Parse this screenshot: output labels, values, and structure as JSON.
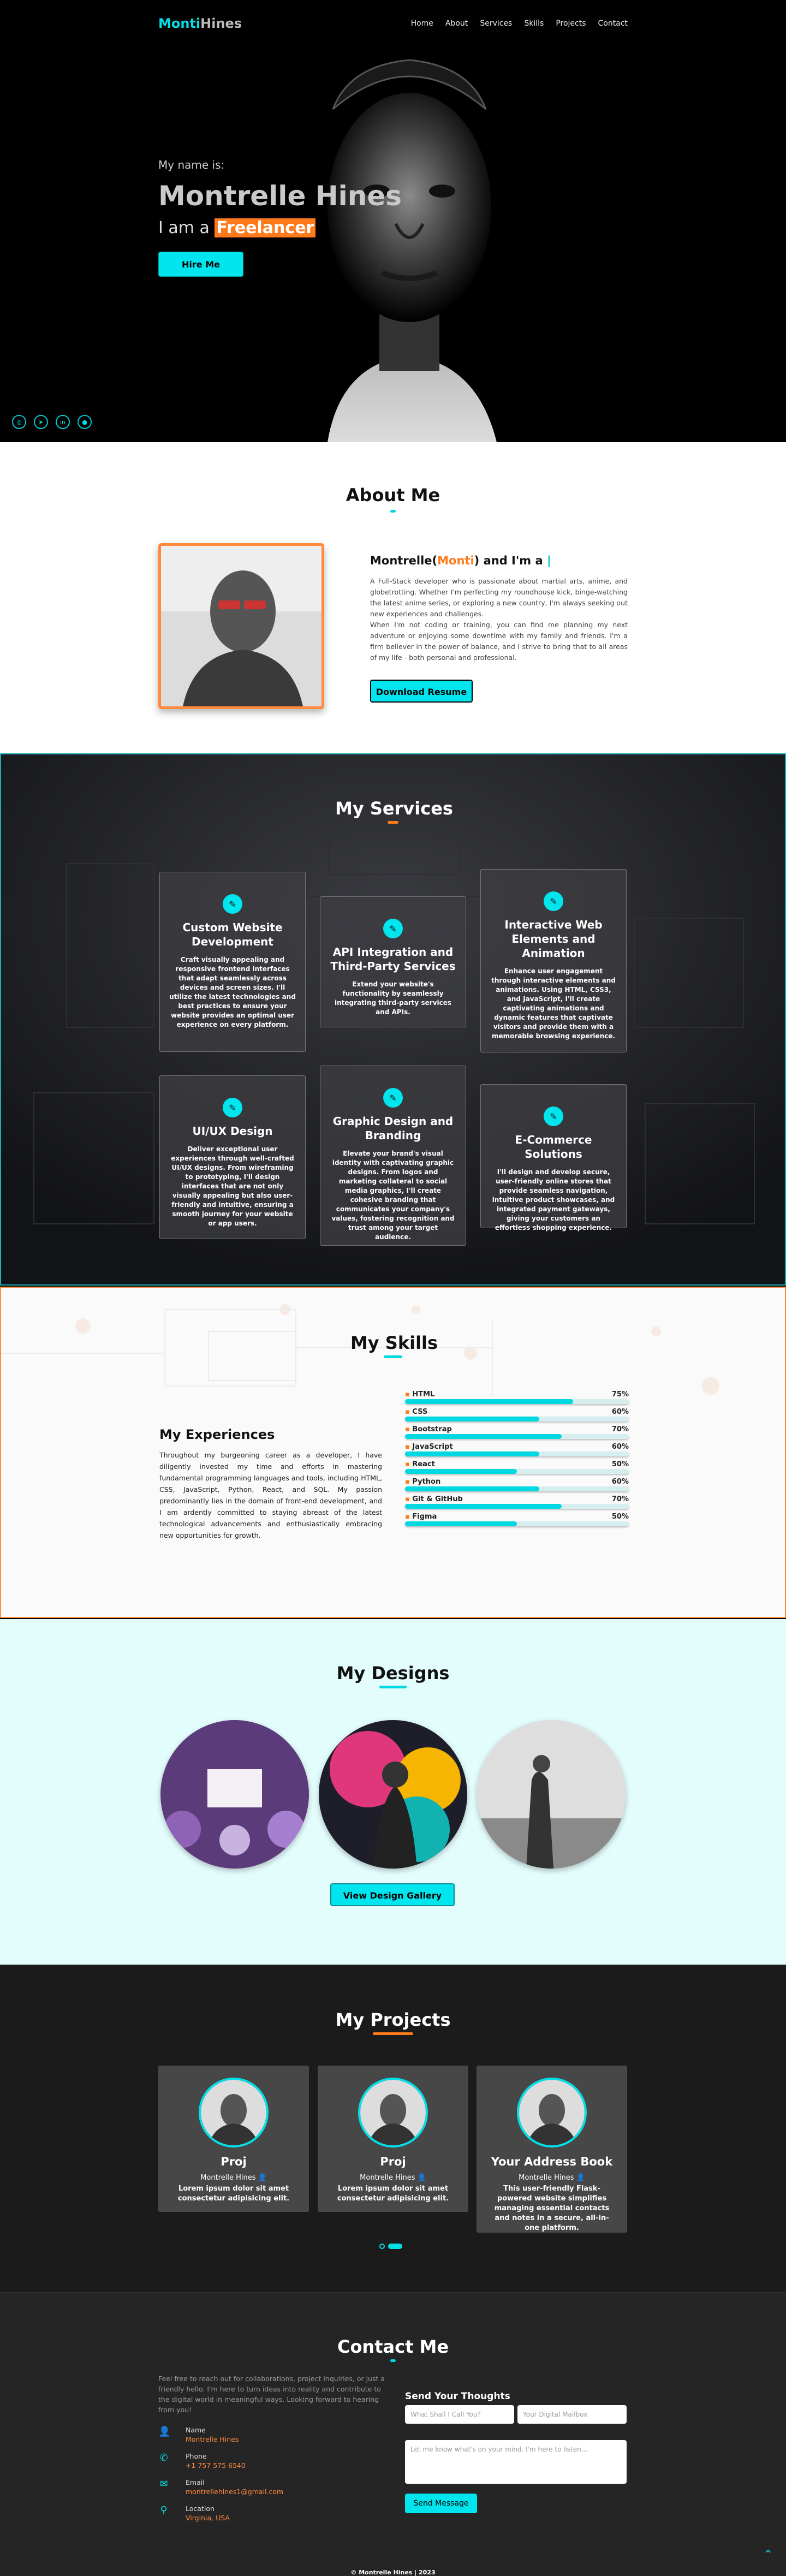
{
  "nav": {
    "logo_first": "Monti",
    "logo_second": "Hines",
    "items": [
      "Home",
      "About",
      "Services",
      "Skills",
      "Projects",
      "Contact"
    ]
  },
  "hero": {
    "greeting": "My name is:",
    "name": "Montrelle Hines",
    "role_prefix": "I am a",
    "role_highlight": "Freelancer",
    "hire_button": "Hire Me",
    "socials": [
      "instagram-icon",
      "telegram-icon",
      "linkedin-icon",
      "github-icon"
    ]
  },
  "about": {
    "title": "About Me",
    "who_prefix": "Montrelle(",
    "who_nick": "Monti",
    "who_suffix": ") and I'm a",
    "paragraph1": "A Full-Stack developer who is passionate about martial arts, anime, and globetrotting. Whether I'm perfecting my roundhouse kick, binge-watching the latest anime series, or exploring a new country, I'm always seeking out new experiences and challenges.",
    "paragraph2": "When I'm not coding or training, you can find me planning my next adventure or enjoying some downtime with my family and friends. I'm a firm believer in the power of balance, and I strive to bring that to all areas of my life - both personal and professional.",
    "download_button": "Download Resume"
  },
  "services": {
    "title": "My Services",
    "cards": [
      {
        "title": "Custom Website Development",
        "text": "Craft visually appealing and responsive frontend interfaces that adapt seamlessly across devices and screen sizes. I'll utilize the latest technologies and best practices to ensure your website provides an optimal user experience on every platform."
      },
      {
        "title": "API Integration and Third-Party Services",
        "text": "Extend your website's functionality by seamlessly integrating third-party services and APIs."
      },
      {
        "title": "Interactive Web Elements and Animation",
        "text": "Enhance user engagement through interactive elements and animations. Using HTML, CSS3, and JavaScript, I'll create captivating animations and dynamic features that captivate visitors and provide them with a memorable browsing experience."
      },
      {
        "title": "UI/UX Design",
        "text": "Deliver exceptional user experiences through well-crafted UI/UX designs. From wireframing to prototyping, I'll design interfaces that are not only visually appealing but also user-friendly and intuitive, ensuring a smooth journey for your website or app users."
      },
      {
        "title": "Graphic Design and Branding",
        "text": "Elevate your brand's visual identity with captivating graphic designs. From logos and marketing collateral to social media graphics, I'll create cohesive branding that communicates your company's values, fostering recognition and trust among your target audience."
      },
      {
        "title": "E-Commerce Solutions",
        "text": "I'll design and develop secure, user-friendly online stores that provide seamless navigation, intuitive product showcases, and integrated payment gateways, giving your customers an effortless shopping experience."
      }
    ]
  },
  "skills": {
    "title": "My Skills",
    "experience_title": "My Experiences",
    "experience_text": "Throughout my burgeoning career as a developer, I have diligently invested my time and efforts in mastering fundamental programming languages and tools, including HTML, CSS, JavaScript, Python, React, and SQL. My passion predominantly lies in the domain of front-end development, and I am ardently committed to staying abreast of the latest technological advancements and enthusiastically embracing new opportunities for growth.",
    "list": [
      {
        "name": "HTML",
        "percent": "75%",
        "value": 75
      },
      {
        "name": "CSS",
        "percent": "60%",
        "value": 60
      },
      {
        "name": "Bootstrap",
        "percent": "70%",
        "value": 70
      },
      {
        "name": "JavaScript",
        "percent": "60%",
        "value": 60
      },
      {
        "name": "React",
        "percent": "50%",
        "value": 50
      },
      {
        "name": "Python",
        "percent": "60%",
        "value": 60
      },
      {
        "name": "Git & GitHub",
        "percent": "70%",
        "value": 70
      },
      {
        "name": "Figma",
        "percent": "50%",
        "value": 50
      }
    ]
  },
  "designs": {
    "title": "My Designs",
    "gallery_button": "View Design Gallery"
  },
  "projects": {
    "title": "My Projects",
    "cards": [
      {
        "title": "Proj",
        "author": "Montrelle Hines",
        "desc": "Lorem ipsum dolor sit amet consectetur adipisicing elit."
      },
      {
        "title": "Proj",
        "author": "Montrelle Hines",
        "desc": "Lorem ipsum dolor sit amet consectetur adipisicing elit."
      },
      {
        "title": "Your Address Book",
        "author": "Montrelle Hines",
        "desc": "This user-friendly Flask-powered website simplifies managing essential contacts and notes in a secure, all-in-one platform."
      }
    ]
  },
  "contact": {
    "title": "Contact Me",
    "intro": "Feel free to reach out for collaborations, project inquiries, or just a friendly hello. I'm here to turn ideas into reality and contribute to the digital world in meaningful ways. Looking forward to hearing from you!",
    "items": [
      {
        "label": "Name",
        "value": "Montrelle Hines"
      },
      {
        "label": "Phone",
        "value": "+1 757 575 6540"
      },
      {
        "label": "Email",
        "value": "montrellehines1@gmail.com"
      },
      {
        "label": "Location",
        "value": "Virginia, USA"
      }
    ],
    "form_title": "Send Your Thoughts",
    "name_placeholder": "What Shall I Call You?",
    "email_placeholder": "Your Digital Mailbox",
    "message_placeholder": "Let me know what's on your mind. I'm here to listen...",
    "send_button": "Send Message",
    "footer": "© Montrelle Hines | 2023"
  }
}
